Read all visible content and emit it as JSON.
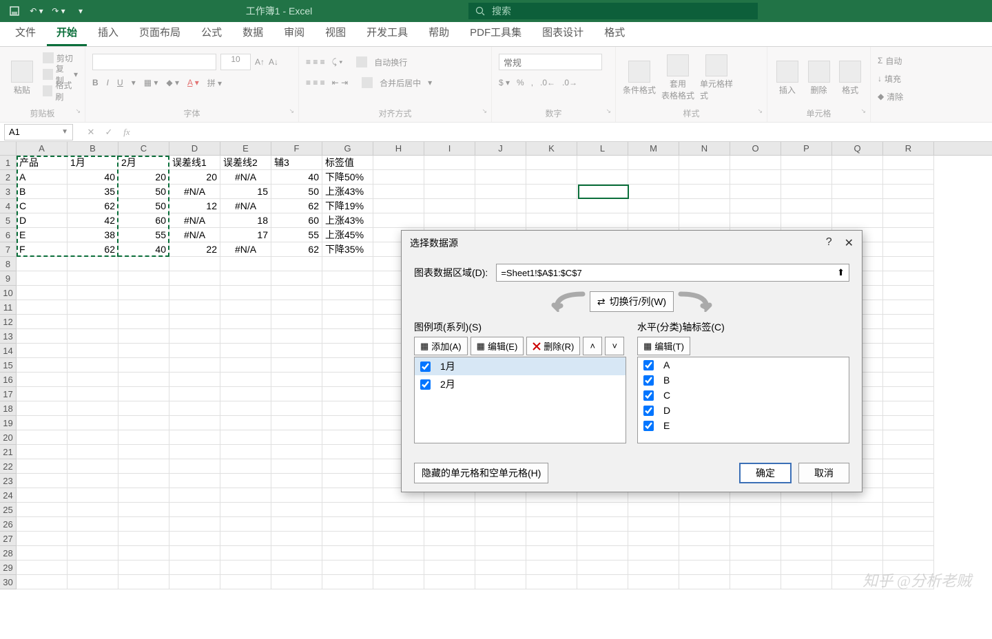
{
  "chart_data": {
    "type": "table",
    "title": "Sheet1 data for chart source",
    "columns": [
      "产品",
      "1月",
      "2月",
      "误差线1",
      "误差线2",
      "辅3",
      "标签值"
    ],
    "rows": [
      {
        "产品": "A",
        "1月": 40,
        "2月": 20,
        "误差线1": 20,
        "误差线2": "#N/A",
        "辅3": 40,
        "标签值": "下降50%"
      },
      {
        "产品": "B",
        "1月": 35,
        "2月": 50,
        "误差线1": "#N/A",
        "误差线2": 15,
        "辅3": 50,
        "标签值": "上涨43%"
      },
      {
        "产品": "C",
        "1月": 62,
        "2月": 50,
        "误差线1": 12,
        "误差线2": "#N/A",
        "辅3": 62,
        "标签值": "下降19%"
      },
      {
        "产品": "D",
        "1月": 42,
        "2月": 60,
        "误差线1": "#N/A",
        "误差线2": 18,
        "辅3": 60,
        "标签值": "上涨43%"
      },
      {
        "产品": "E",
        "1月": 38,
        "2月": 55,
        "误差线1": "#N/A",
        "误差线2": 17,
        "辅3": 55,
        "标签值": "上涨45%"
      },
      {
        "产品": "F",
        "1月": 62,
        "2月": 40,
        "误差线1": 22,
        "误差线2": "#N/A",
        "辅3": 62,
        "标签值": "下降35%"
      }
    ]
  },
  "titlebar": {
    "title": "工作簿1 - Excel",
    "search_placeholder": "搜索"
  },
  "tabs": [
    "文件",
    "开始",
    "插入",
    "页面布局",
    "公式",
    "数据",
    "审阅",
    "视图",
    "开发工具",
    "帮助",
    "PDF工具集",
    "图表设计",
    "格式"
  ],
  "active_tab_index": 1,
  "ribbon": {
    "clipboard": {
      "paste": "粘贴",
      "cut": "剪切",
      "copy": "复制",
      "format_painter": "格式刷",
      "label": "剪贴板"
    },
    "font": {
      "size": "10",
      "label": "字体"
    },
    "align": {
      "wrap": "自动换行",
      "merge": "合并后居中",
      "label": "对齐方式"
    },
    "number": {
      "general": "常规",
      "label": "数字"
    },
    "styles": {
      "cond": "条件格式",
      "table": "套用\n表格格式",
      "cell": "单元格样式",
      "label": "样式"
    },
    "cells": {
      "insert": "插入",
      "delete": "删除",
      "format": "格式",
      "label": "单元格"
    },
    "editing": {
      "autosum": "自动",
      "fill": "填充",
      "clear": "清除"
    }
  },
  "formula_bar": {
    "name_box": "A1"
  },
  "columns": [
    "A",
    "B",
    "C",
    "D",
    "E",
    "F",
    "G",
    "H",
    "I",
    "J",
    "K",
    "L",
    "M",
    "N",
    "O",
    "P",
    "Q",
    "R"
  ],
  "dialog": {
    "title": "选择数据源",
    "range_label": "图表数据区域(D):",
    "range_value": "=Sheet1!$A$1:$C$7",
    "switch": "切换行/列(W)",
    "legend_title": "图例项(系列)(S)",
    "legend_add": "添加(A)",
    "legend_edit": "编辑(E)",
    "legend_delete": "删除(R)",
    "legend_items": [
      "1月",
      "2月"
    ],
    "axis_title": "水平(分类)轴标签(C)",
    "axis_edit": "编辑(T)",
    "axis_items": [
      "A",
      "B",
      "C",
      "D",
      "E"
    ],
    "hidden_cells": "隐藏的单元格和空单元格(H)",
    "ok": "确定",
    "cancel": "取消"
  },
  "watermark": "知乎 @分析老贼"
}
